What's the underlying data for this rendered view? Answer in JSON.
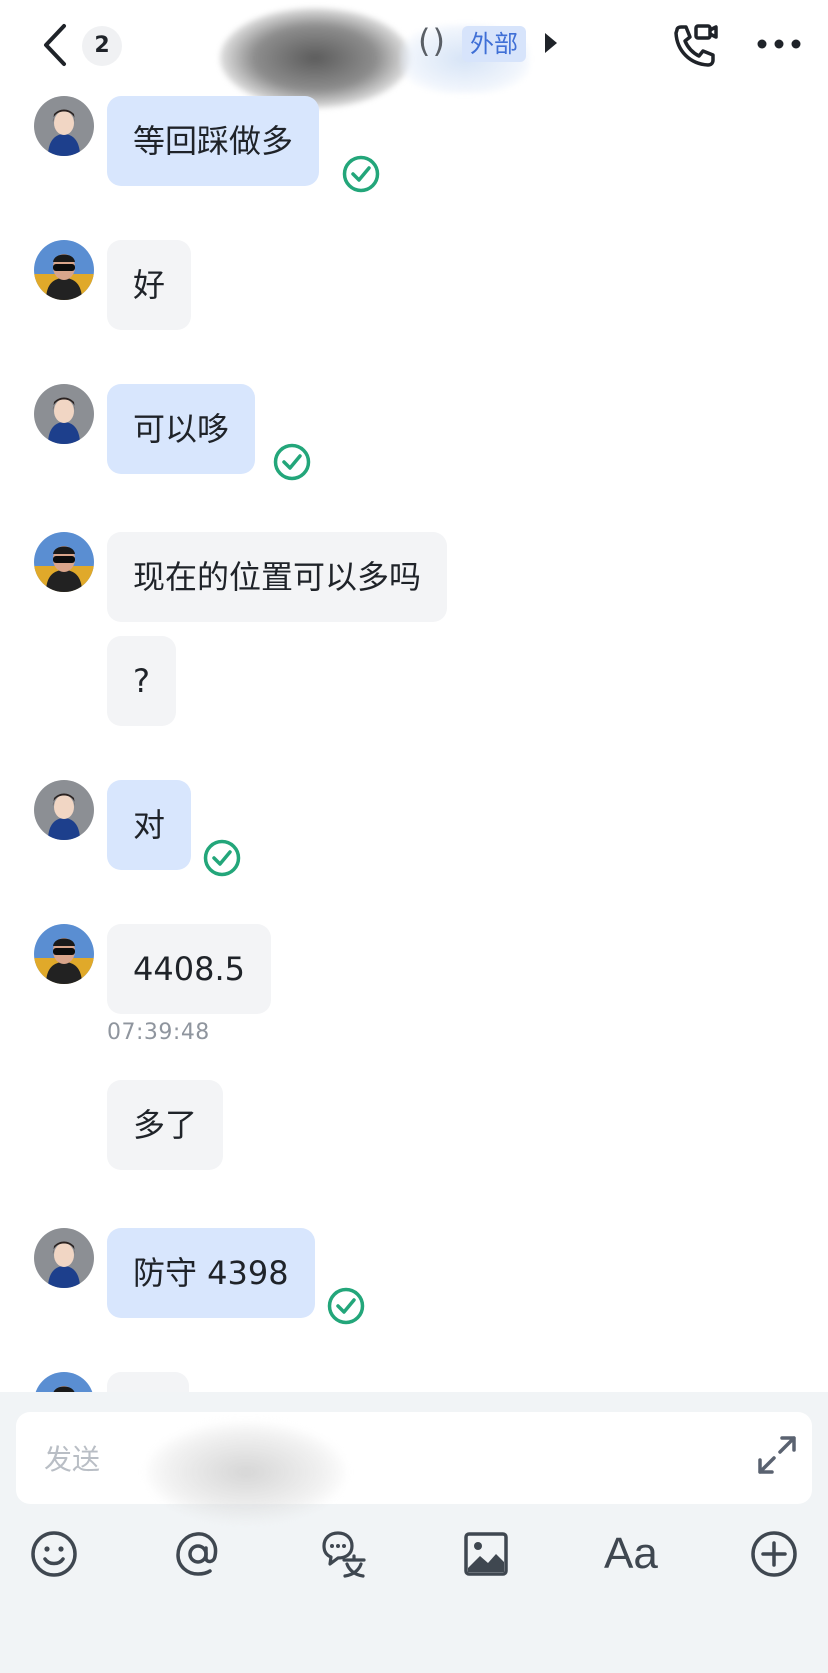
{
  "header": {
    "unread_count": "2",
    "title_paren": "()",
    "external_tag": "外部",
    "icons": [
      "chevron-left-icon",
      "caret-right-icon",
      "video-call-icon",
      "more-icon"
    ]
  },
  "messages": [
    {
      "sender": "self",
      "text": "等回踩做多",
      "read": true
    },
    {
      "sender": "other",
      "text": "好"
    },
    {
      "sender": "self",
      "text": "可以哆",
      "read": true
    },
    {
      "sender": "other",
      "text": "现在的位置可以多吗"
    },
    {
      "sender": "other",
      "text": "?"
    },
    {
      "sender": "self",
      "text": "对",
      "read": true
    },
    {
      "sender": "other",
      "text": "4408.5",
      "timestamp": "07:39:48"
    },
    {
      "sender": "other",
      "text": "多了"
    },
    {
      "sender": "self",
      "text": "防守 4398",
      "read": true
    }
  ],
  "composer": {
    "placeholder": "发送",
    "toolbar_icons": [
      "emoji-icon",
      "mention-icon",
      "translate-icon",
      "image-icon",
      "font-format-icon",
      "add-icon"
    ],
    "font_format_label": "Aa"
  },
  "colors": {
    "self_bubble": "#d8e6fd",
    "other_bubble": "#f3f4f6",
    "read_check": "#23a67a",
    "external_tag_bg": "#d7e4fb",
    "external_tag_text": "#3f6fd6",
    "composer_bg": "#f1f4f6"
  }
}
